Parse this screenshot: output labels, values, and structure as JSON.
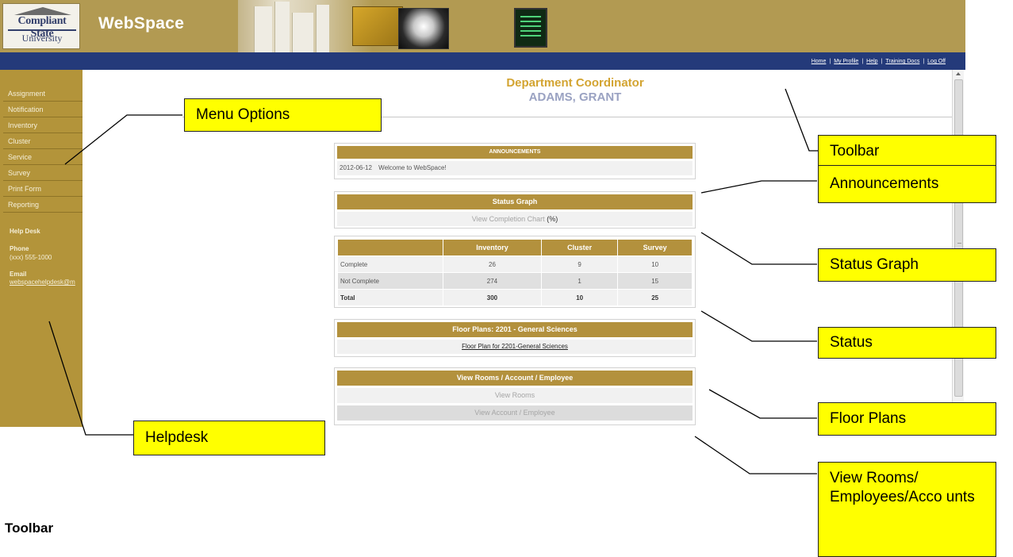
{
  "app": {
    "logo_line1": "Compliant State",
    "logo_line2": "University",
    "brand": "WebSpace"
  },
  "toolbar_links": [
    "Home",
    "My Profile",
    "Help",
    "Training Docs",
    "Log Off"
  ],
  "toolbar_separator": "|",
  "menu": [
    "Assignment",
    "Notification",
    "Inventory",
    "Cluster",
    "Service",
    "Survey",
    "Print Form",
    "Reporting"
  ],
  "helpdesk": {
    "title": "Help Desk",
    "phone_label": "Phone",
    "phone": "(xxx) 555-1000",
    "email_label": "Email",
    "email": "webspacehelpdesk@m"
  },
  "header": {
    "role": "Department Coordinator",
    "name": "ADAMS, GRANT"
  },
  "announcements": {
    "title": "ANNOUNCEMENTS",
    "date": "2012-06-12",
    "message": "Welcome to WebSpace!"
  },
  "status_graph": {
    "title": "Status Graph",
    "link": "View Completion Chart",
    "suffix": "(%)"
  },
  "status_table": {
    "columns": [
      "",
      "Inventory",
      "Cluster",
      "Survey"
    ],
    "rows": [
      {
        "label": "Complete",
        "values": [
          "26",
          "9",
          "10"
        ]
      },
      {
        "label": "Not Complete",
        "values": [
          "274",
          "1",
          "15"
        ]
      },
      {
        "label": "Total",
        "values": [
          "300",
          "10",
          "25"
        ]
      }
    ]
  },
  "floor_plans": {
    "title": "Floor Plans: 2201 - General Sciences",
    "link": "Floor Plan for 2201-General Sciences"
  },
  "view_rooms": {
    "title": "View Rooms / Account / Employee",
    "link_rooms": "View Rooms",
    "link_account": "View Account / Employee"
  },
  "callouts": {
    "menu_options": "Menu Options",
    "toolbar": "Toolbar",
    "announcements": "Announcements",
    "status_graph": "Status Graph",
    "status": "Status",
    "floor_plans": "Floor Plans",
    "view_rooms": "View Rooms/ Employees/Acco unts",
    "helpdesk": "Helpdesk"
  },
  "caption": "Toolbar",
  "colors": {
    "banner": "#b29a52",
    "navbar": "#243a7a",
    "sidebar": "#b3943a",
    "panel_header": "#b3913d",
    "role_text": "#d3a431",
    "name_text": "#9aa2c2",
    "callout": "#ffff00"
  }
}
